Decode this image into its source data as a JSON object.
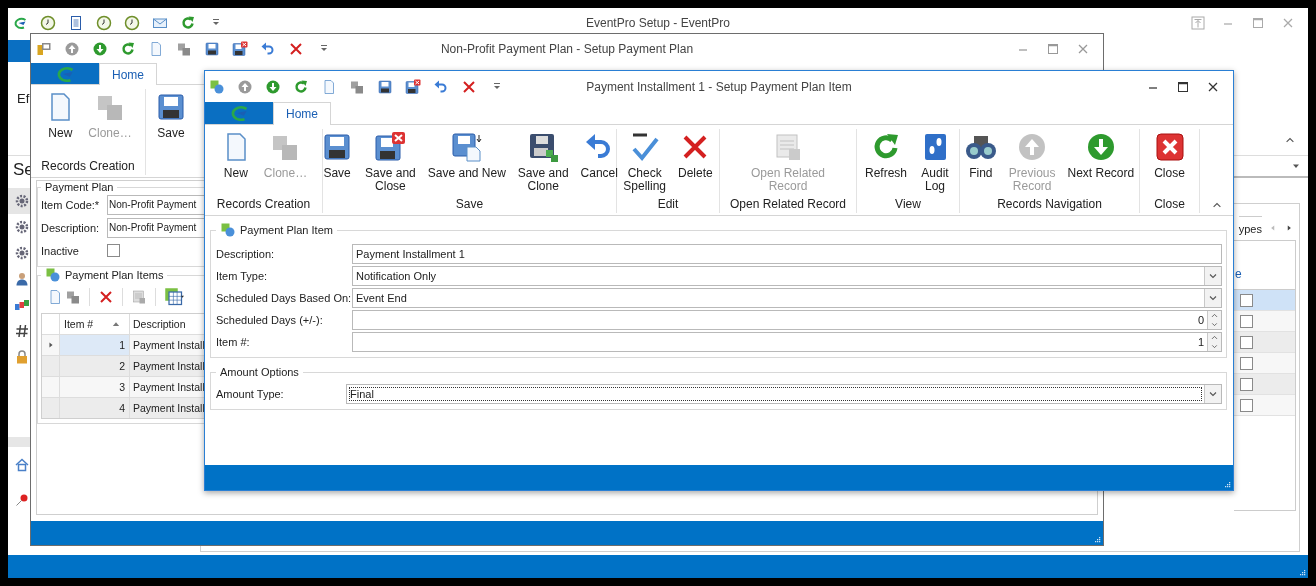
{
  "main_window": {
    "title": "EventPro Setup - EventPro",
    "partial_label": "Ef",
    "partial_heading": "Se",
    "sidebar": {
      "items": [
        {
          "selected": true
        },
        {
          "selected": false
        },
        {
          "selected": false
        },
        {
          "selected": false
        },
        {
          "selected": false
        },
        {
          "selected": false
        },
        {
          "selected": false
        }
      ]
    },
    "panel_tab": "ypes",
    "column_header": "e",
    "rows": [
      {
        "selected": true,
        "checked": false
      },
      {
        "selected": false,
        "checked": false
      },
      {
        "selected": false,
        "checked": false
      },
      {
        "selected": false,
        "checked": false
      },
      {
        "selected": false,
        "checked": false
      },
      {
        "selected": false,
        "checked": false
      }
    ]
  },
  "plan_window": {
    "title": "Non-Profit Payment Plan - Setup Payment Plan",
    "tab": {
      "label": "Home",
      "selected": true
    },
    "ribbon": {
      "groups": [
        {
          "label": "Records Creation",
          "buttons": [
            {
              "label": "New",
              "disabled": false
            },
            {
              "label": "Clone…",
              "disabled": true
            }
          ]
        },
        {
          "buttons": [
            {
              "label": "Save",
              "disabled": false
            }
          ]
        }
      ]
    },
    "payment_plan": {
      "title": "Payment Plan",
      "fields": [
        {
          "label": "Item Code:*",
          "value": "Non-Profit Payment"
        },
        {
          "label": "Description:",
          "value": "Non-Profit Payment"
        }
      ],
      "inactive": {
        "label": "Inactive",
        "checked": false
      }
    },
    "plan_items": {
      "title": "Payment Plan Items",
      "columns": [
        {
          "label": "Item #",
          "sorted": true
        },
        {
          "label": "Description",
          "sorted": false
        }
      ],
      "rows": [
        {
          "item": "1",
          "description": "Payment Install",
          "selected": true
        },
        {
          "item": "2",
          "description": "Payment Install",
          "selected": false
        },
        {
          "item": "3",
          "description": "Payment Install",
          "selected": false
        },
        {
          "item": "4",
          "description": "Payment Install",
          "selected": false
        }
      ]
    }
  },
  "item_window": {
    "title": "Payment Installment 1 - Setup Payment Plan Item",
    "tab": {
      "label": "Home",
      "selected": true
    },
    "ribbon": {
      "groups": [
        {
          "label": "Records Creation",
          "buttons": [
            {
              "label": "New",
              "disabled": false
            },
            {
              "label": "Clone…",
              "disabled": true
            }
          ]
        },
        {
          "label": "Save",
          "buttons": [
            {
              "label": "Save",
              "disabled": false
            },
            {
              "label": "Save and\nClose",
              "disabled": false
            },
            {
              "label": "Save and New",
              "disabled": false
            },
            {
              "label": "Save and\nClone",
              "disabled": false
            },
            {
              "label": "Cancel",
              "disabled": false
            }
          ]
        },
        {
          "label": "Edit",
          "buttons": [
            {
              "label": "Check\nSpelling",
              "disabled": false
            },
            {
              "label": "Delete",
              "disabled": false
            }
          ]
        },
        {
          "label": "Open Related Record",
          "buttons": [
            {
              "label": "Open Related\nRecord",
              "disabled": true
            }
          ]
        },
        {
          "label": "View",
          "buttons": [
            {
              "label": "Refresh",
              "disabled": false
            },
            {
              "label": "Audit\nLog",
              "disabled": false
            }
          ]
        },
        {
          "label": "Records Navigation",
          "buttons": [
            {
              "label": "Find",
              "disabled": false
            },
            {
              "label": "Previous\nRecord",
              "disabled": true
            },
            {
              "label": "Next Record",
              "disabled": false
            }
          ]
        },
        {
          "label": "Close",
          "buttons": [
            {
              "label": "Close",
              "disabled": false
            }
          ]
        }
      ]
    },
    "item": {
      "title": "Payment Plan Item",
      "fields": [
        {
          "kind": "text",
          "label": "Description:",
          "value": "Payment Installment 1",
          "focused": false
        },
        {
          "kind": "dropdown",
          "label": "Item Type:",
          "value": "Notification Only",
          "focused": false
        },
        {
          "kind": "dropdown",
          "label": "Scheduled Days Based On:",
          "value": "Event End",
          "focused": false
        },
        {
          "kind": "spinner",
          "label": "Scheduled Days (+/-):",
          "value": "0",
          "focused": false
        },
        {
          "kind": "spinner",
          "label": "Item #:",
          "value": "1",
          "focused": false
        }
      ]
    },
    "amount_options": {
      "title": "Amount Options",
      "fields": [
        {
          "kind": "dropdown",
          "label": "Amount Type:",
          "value": "Final",
          "focused": true
        }
      ]
    }
  }
}
